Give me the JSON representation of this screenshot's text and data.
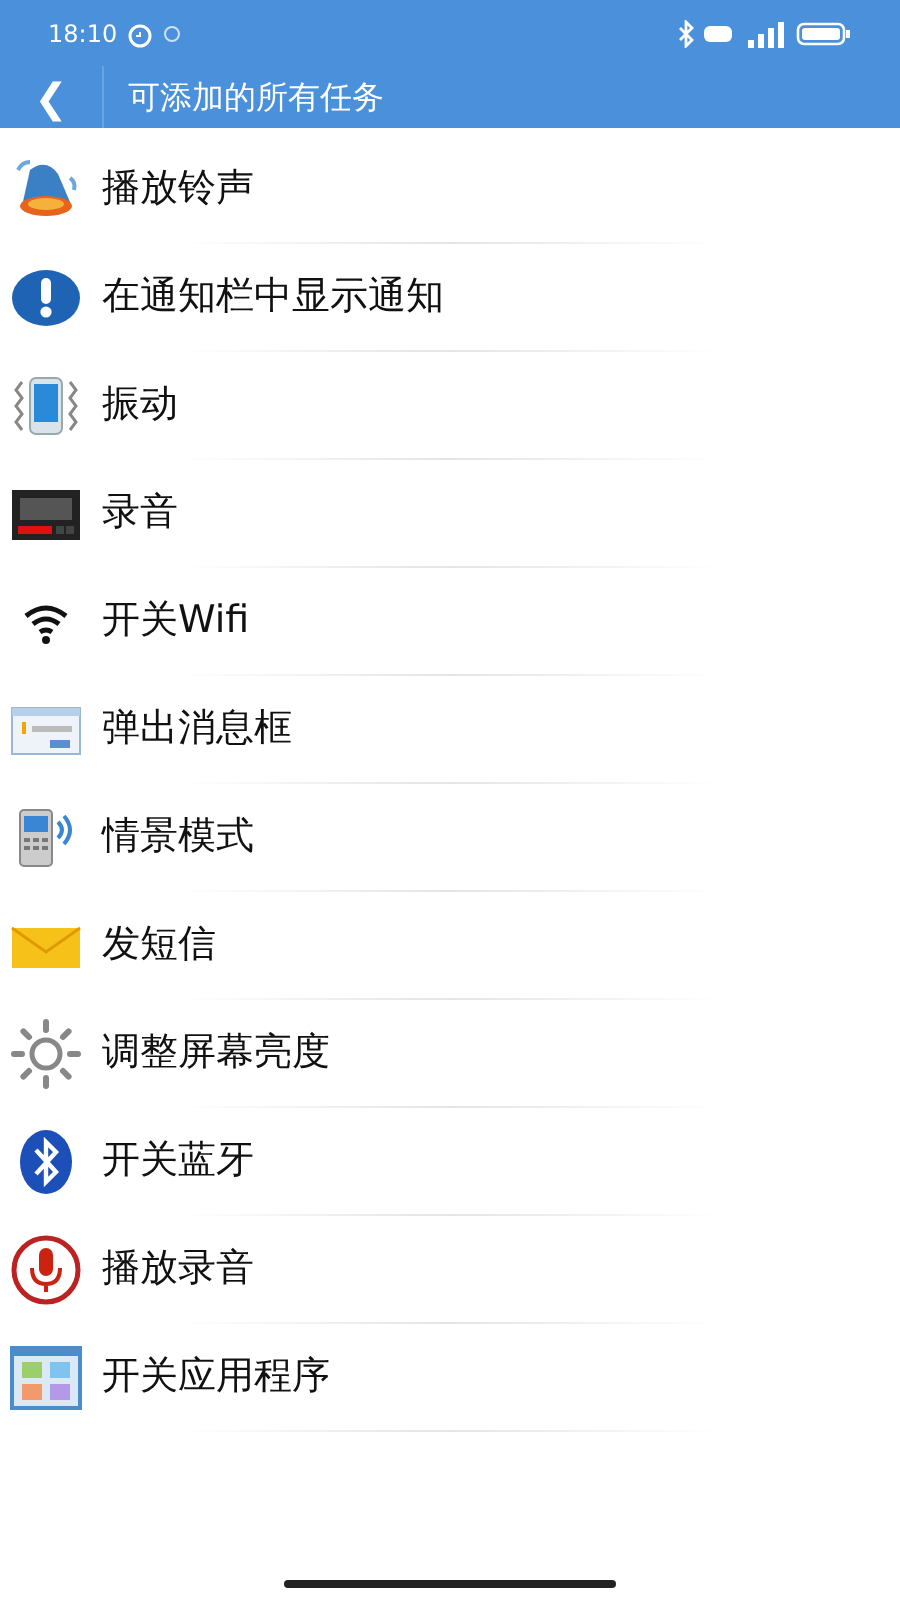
{
  "status_bar": {
    "time": "18:10"
  },
  "header": {
    "back": "❮",
    "title": "可添加的所有任务"
  },
  "tasks": [
    {
      "kind": "bell",
      "label": "播放铃声"
    },
    {
      "kind": "alert",
      "label": "在通知栏中显示通知"
    },
    {
      "kind": "vibrate",
      "label": "振动"
    },
    {
      "kind": "recorder",
      "label": "录音"
    },
    {
      "kind": "wifi",
      "label": "开关Wifi"
    },
    {
      "kind": "dialog",
      "label": "弹出消息框"
    },
    {
      "kind": "phone",
      "label": "情景模式"
    },
    {
      "kind": "mail",
      "label": "发短信"
    },
    {
      "kind": "sun",
      "label": "调整屏幕亮度"
    },
    {
      "kind": "bluetooth",
      "label": "开关蓝牙"
    },
    {
      "kind": "mic",
      "label": "播放录音"
    },
    {
      "kind": "apps",
      "label": "开关应用程序"
    }
  ]
}
